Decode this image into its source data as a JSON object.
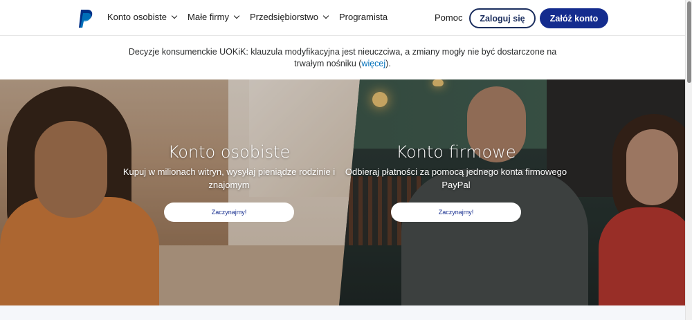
{
  "header": {
    "logo_icon": "paypal-logo",
    "brand_color": "#142c8e",
    "nav": [
      {
        "label": "Konto osobiste",
        "has_dropdown": true
      },
      {
        "label": "Małe firmy",
        "has_dropdown": true
      },
      {
        "label": "Przedsiębiorstwo",
        "has_dropdown": true
      },
      {
        "label": "Programista",
        "has_dropdown": false
      }
    ],
    "help_label": "Pomoc",
    "login_label": "Zaloguj się",
    "signup_label": "Załóż konto"
  },
  "notice": {
    "text_before": "Decyzje konsumenckie UOKiK: klauzula modyfikacyjna jest nieuczciwa, a zmiany mogły nie być dostarczone na trwałym nośniku (",
    "link_label": "więcej",
    "text_after": ")."
  },
  "hero": {
    "personal": {
      "title": "Konto osobiste",
      "subtitle": "Kupuj w milionach witryn, wysyłaj pieniądze rodzinie i znajomym",
      "cta_label": "Zaczynajmy!"
    },
    "business": {
      "title": "Konto firmowe",
      "subtitle": "Odbieraj płatności za pomocą jednego konta firmowego PayPal",
      "cta_label": "Zaczynajmy!"
    }
  },
  "strip": {
    "text": ""
  }
}
